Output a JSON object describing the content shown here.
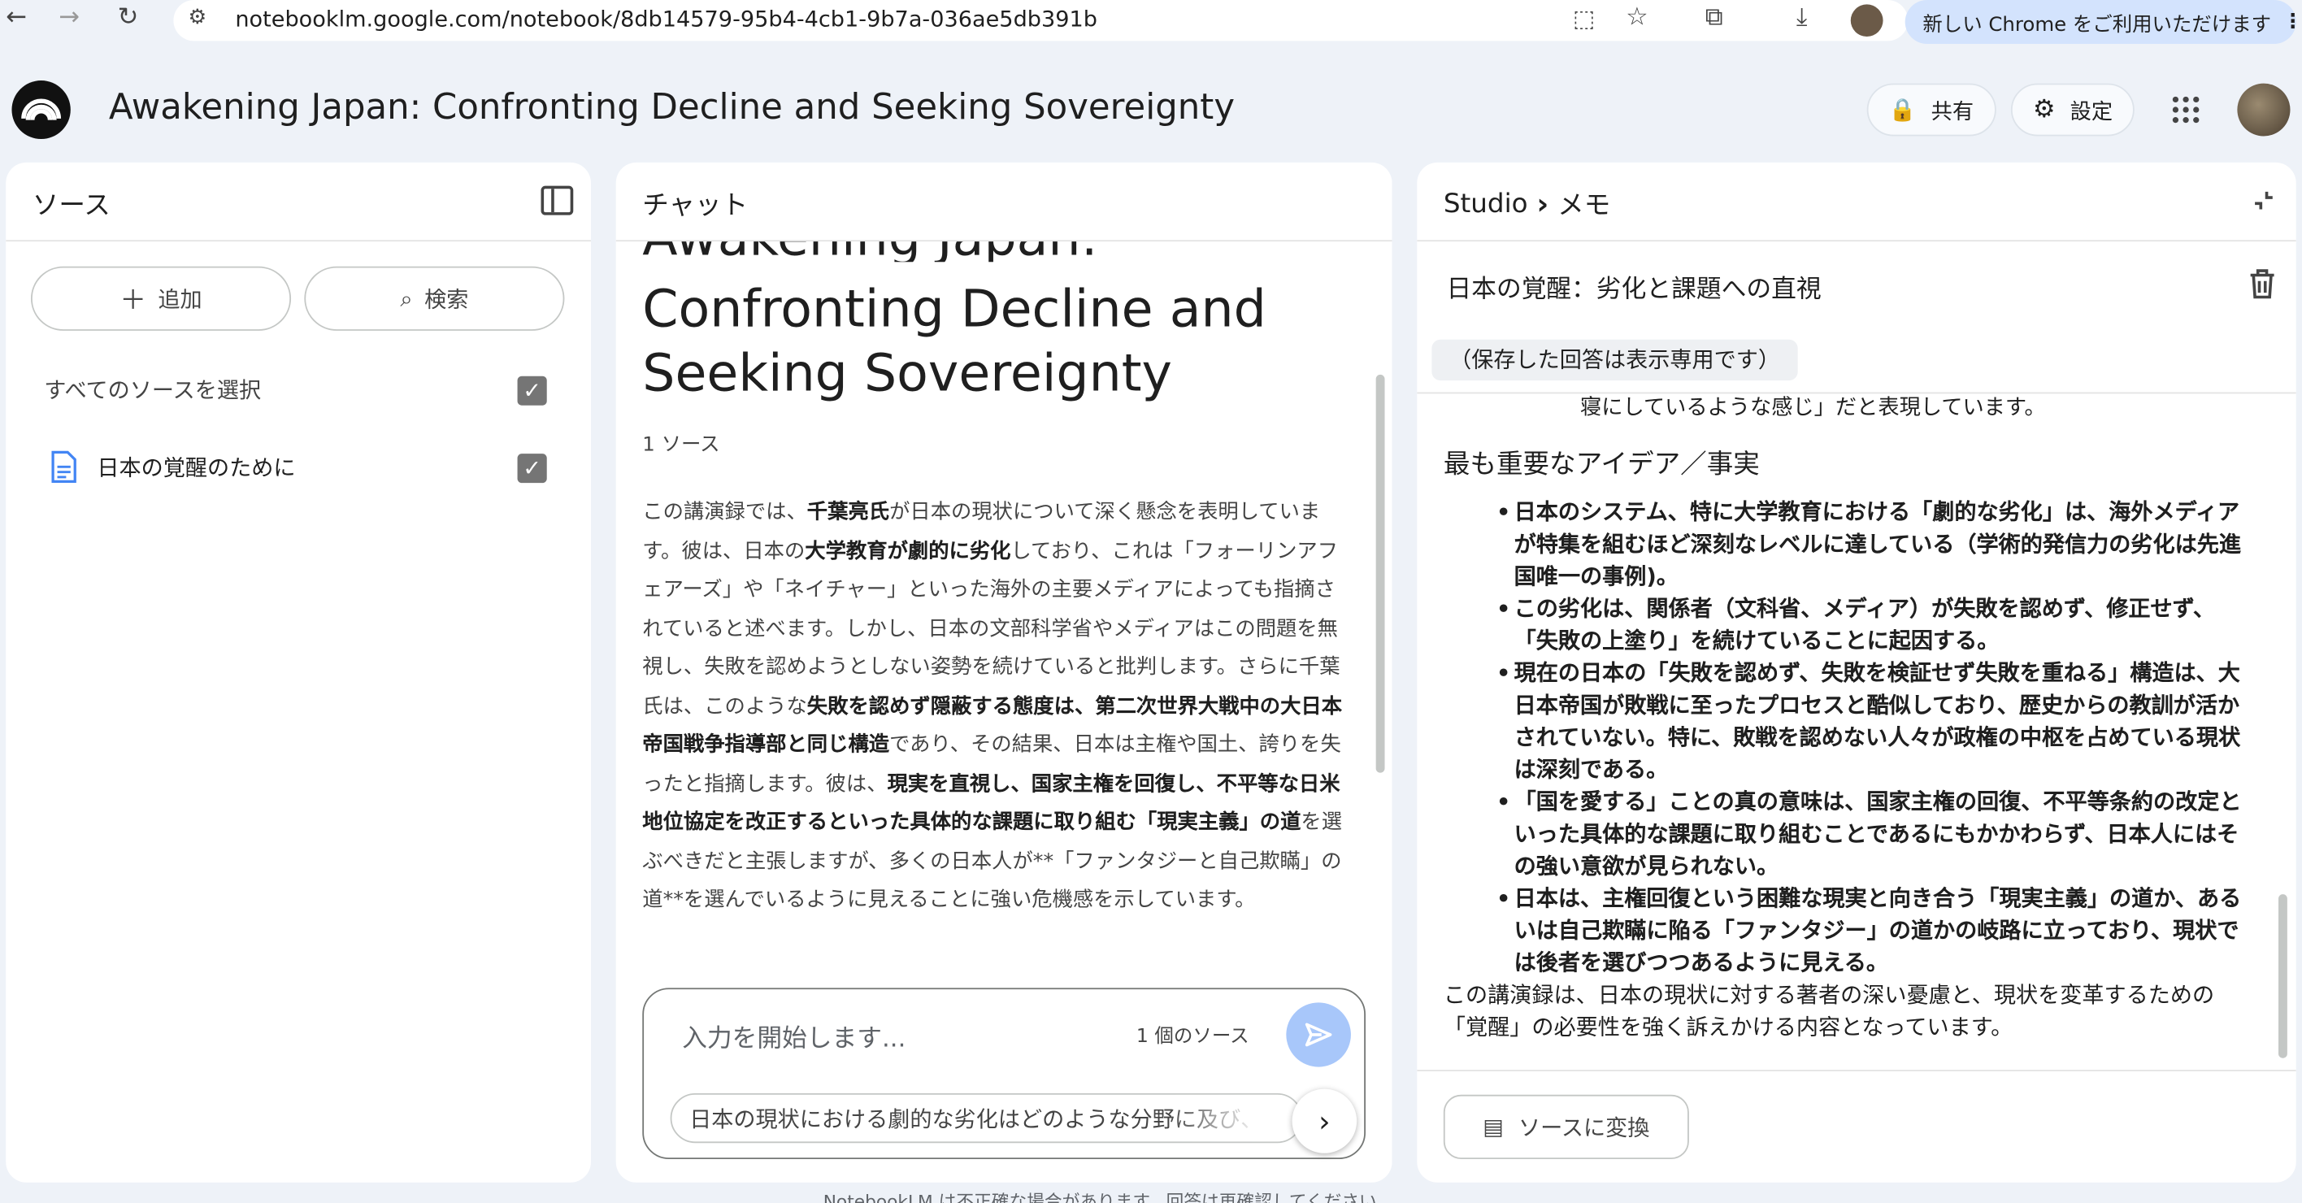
{
  "browser": {
    "url": "notebooklm.google.com/notebook/8db14579-95b4-4cb1-9b7a-036ae5db391b",
    "promo": "新しい Chrome をご利用いただけます"
  },
  "header": {
    "title": "Awakening Japan: Confronting Decline and Seeking Sovereignty",
    "share_label": "共有",
    "settings_label": "設定"
  },
  "sources": {
    "title": "ソース",
    "add_label": "追加",
    "search_label": "検索",
    "select_all_label": "すべてのソースを選択",
    "items": [
      {
        "name": "日本の覚醒のために",
        "checked": true
      }
    ]
  },
  "chat": {
    "title": "チャット",
    "heading_line1": "Confronting Decline and",
    "heading_line2": "Seeking Sovereignty",
    "source_count": "1 ソース",
    "summary": [
      {
        "t": "この講演録では、"
      },
      {
        "t": "千葉亮氏",
        "b": true
      },
      {
        "t": "が日本の現状について深く懸念を表明しています。彼は、日本の"
      },
      {
        "t": "大学教育が劇的に劣化",
        "b": true
      },
      {
        "t": "しており、これは「フォーリンアフェアーズ」や「ネイチャー」といった海外の主要メディアによっても指摘されていると述べます。しかし、日本の文部科学省やメディアはこの問題を無視し、失敗を認めようとしない姿勢を続けていると批判します。さらに千葉氏は、このような"
      },
      {
        "t": "失敗を認めず隠蔽する態度は、第二次世界大戦中の大日本帝国戦争指導部と同じ構造",
        "b": true
      },
      {
        "t": "であり、その結果、日本は主権や国土、誇りを失ったと指摘します。彼は、"
      },
      {
        "t": "現実を直視し、国家主権を回復し、不平等な日米地位協定を改正するといった具体的な課題に取り組む「現実主義」の道",
        "b": true
      },
      {
        "t": "を選ぶべきだと主張しますが、多くの日本人が**「ファンタジーと自己欺瞞」の道**を選んでいるように見えることに強い危機感を示しています。"
      }
    ],
    "input_placeholder": "入力を開始します...",
    "input_source_count": "1 個のソース",
    "suggestion": "日本の現状における劇的な劣化はどのような分野に及び、それ",
    "footer_notice": "NotebookLM は不正確な場合があります。回答は再確認してください。"
  },
  "studio": {
    "breadcrumb_root": "Studio",
    "breadcrumb_current": "メモ",
    "note_title": "日本の覚醒：劣化と課題への直視",
    "readonly_badge": "（保存した回答は表示専用です）",
    "truncated_line": "寝にしているような感じ」だと表現しています。",
    "section_heading": "最も重要なアイデア／事実",
    "bullets": [
      "日本のシステム、特に大学教育における「劇的な劣化」は、海外メディアが特集を組むほど深刻なレベルに達している（学術的発信力の劣化は先進国唯一の事例)。",
      "この劣化は、関係者（文科省、メディア）が失敗を認めず、修正せず、「失敗の上塗り」を続けていることに起因する。",
      "現在の日本の「失敗を認めず、失敗を検証せず失敗を重ねる」構造は、大日本帝国が敗戦に至ったプロセスと酷似しており、歴史からの教訓が活かされていない。特に、敗戦を認めない人々が政権の中枢を占めている現状は深刻である。",
      "「国を愛する」ことの真の意味は、国家主権の回復、不平等条約の改定といった具体的な課題に取り組むことであるにもかかわらず、日本人にはその強い意欲が見られない。",
      "日本は、主権回復という困難な現実と向き合う「現実主義」の道か、あるいは自己欺瞞に陥る「ファンタジー」の道かの岐路に立っており、現状では後者を選びつつあるように見える。"
    ],
    "conclusion": "この講演録は、日本の現状に対する著者の深い憂慮と、現状を変革するための「覚醒」の必要性を強く訴えかける内容となっています。",
    "convert_label": "ソースに変換"
  },
  "colors": {
    "accent": "#a8c7fa",
    "page_bg": "#eef2f8",
    "panel_bg": "#ffffff"
  }
}
